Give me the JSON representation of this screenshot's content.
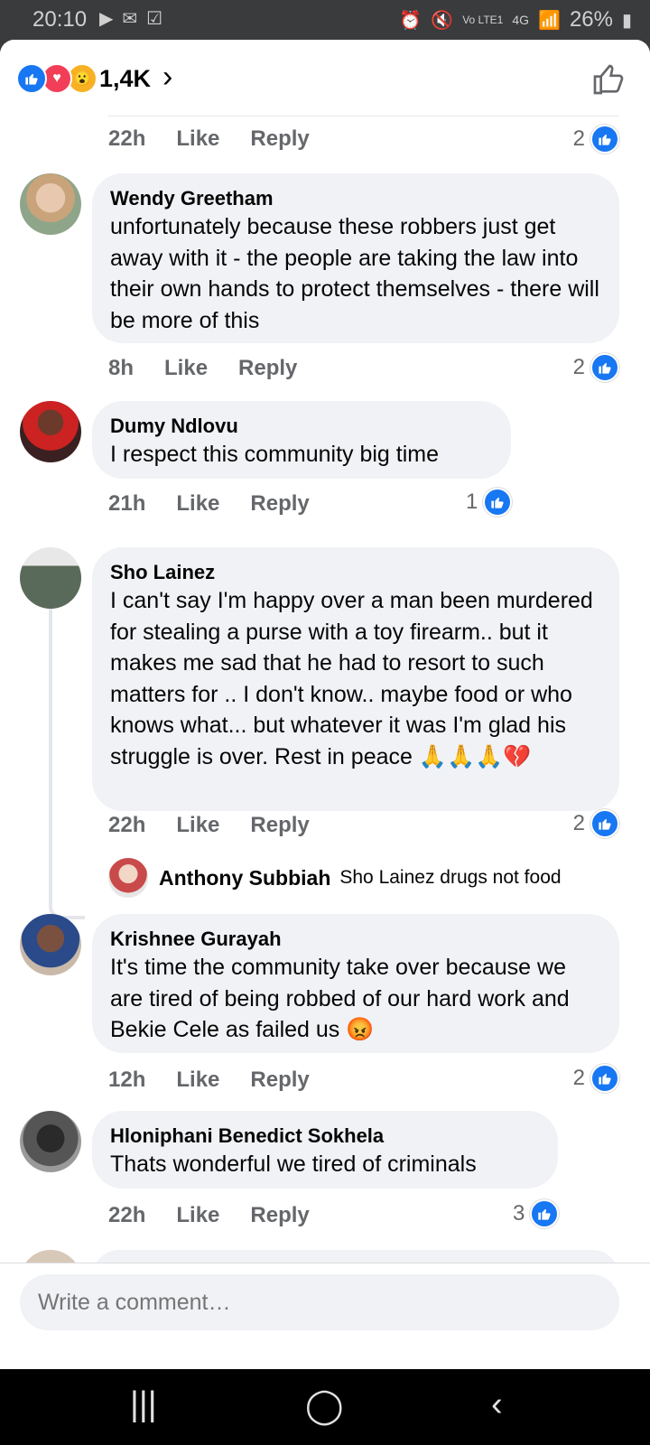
{
  "status_bar": {
    "time": "20:10",
    "battery": "26%",
    "left_icons": [
      "play-icon",
      "mail-icon",
      "check-icon"
    ],
    "right_icons": [
      "alarm-icon",
      "mute-icon",
      "volte-icon",
      "4g-icon",
      "signal-icon",
      "battery-icon"
    ]
  },
  "header": {
    "reaction_count": "1,4K",
    "reactions": [
      "like",
      "love",
      "wow"
    ]
  },
  "top_meta": {
    "time": "22h",
    "like": "Like",
    "reply": "Reply",
    "count": "2"
  },
  "comments": [
    {
      "name": "Wendy Greetham",
      "text": "unfortunately because these robbers just get away with it - the people are taking the law into their own hands to protect themselves  - there will be more of this",
      "time": "8h",
      "like": "Like",
      "reply": "Reply",
      "count": "2"
    },
    {
      "name": "Dumy Ndlovu",
      "text": "I respect this community big time",
      "time": "21h",
      "like": "Like",
      "reply": "Reply",
      "count": "1"
    },
    {
      "name": "Sho Lainez",
      "text": "I can't say I'm happy over a man been murdered for stealing a purse with a toy firearm.. but it makes me sad that he had to resort to such matters for .. I don't know.. maybe food or who knows what... but whatever it was I'm glad his struggle is over. Rest in peace 🙏🙏🙏💔",
      "time": "22h",
      "like": "Like",
      "reply": "Reply",
      "count": "2"
    },
    {
      "name": "Krishnee Gurayah",
      "text": "It's time the community take over because we are tired of being robbed of our hard work and Bekie Cele as failed us 😡",
      "time": "12h",
      "like": "Like",
      "reply": "Reply",
      "count": "2"
    },
    {
      "name": "Hloniphani Benedict Sokhela",
      "text": "Thats wonderful  we tired of criminals",
      "time": "22h",
      "like": "Like",
      "reply": "Reply",
      "count": "3"
    }
  ],
  "nested_reply": {
    "name": "Anthony Subbiah",
    "text": "Sho Lainez drugs not food"
  },
  "composer": {
    "placeholder": "Write a comment…"
  },
  "colors": {
    "accent": "#1877f2",
    "bubble": "#f0f2f5",
    "meta": "#65676b"
  }
}
